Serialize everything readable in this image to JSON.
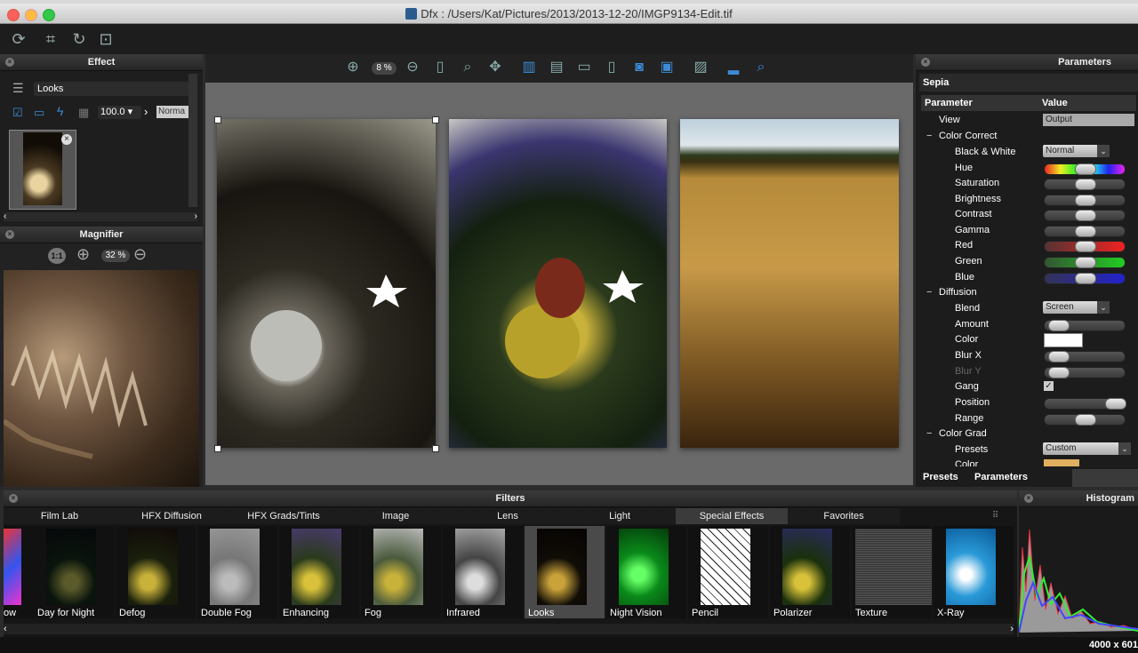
{
  "window": {
    "title": "Dfx : /Users/Kat/Pictures/2013/2013-12-20/IMGP9134-Edit.tif"
  },
  "effect_panel": {
    "title": "Effect",
    "preset_name": "Looks",
    "opacity_value": "100.0",
    "blend_mode": "Norma"
  },
  "magnifier": {
    "title": "Magnifier",
    "ratio_label": "1:1",
    "zoom": "32 %"
  },
  "view_toolbar": {
    "zoom": "8 %"
  },
  "parameters": {
    "title": "Parameters",
    "effect_name": "Sepia",
    "col_parameter": "Parameter",
    "col_value": "Value",
    "view_label": "View",
    "view_value": "Output",
    "color_correct": "Color Correct",
    "bw_label": "Black & White",
    "bw_value": "Normal",
    "hue": "Hue",
    "saturation": "Saturation",
    "brightness": "Brightness",
    "contrast": "Contrast",
    "gamma": "Gamma",
    "red": "Red",
    "green": "Green",
    "blue": "Blue",
    "diffusion": "Diffusion",
    "blend": "Blend",
    "blend_value": "Screen",
    "amount": "Amount",
    "color": "Color",
    "blur_x": "Blur X",
    "blur_y": "Blur Y",
    "gang": "Gang",
    "position": "Position",
    "range": "Range",
    "color_grad": "Color Grad",
    "presets": "Presets",
    "presets_value": "Custom",
    "grad_color": "Color",
    "tab_presets": "Presets",
    "tab_parameters": "Parameters"
  },
  "filters": {
    "title": "Filters",
    "tabs": [
      "Film Lab",
      "HFX Diffusion",
      "HFX Grads/Tints",
      "Image",
      "Lens",
      "Light",
      "Special Effects",
      "Favorites"
    ],
    "items": [
      "ow",
      "Day for Night",
      "Defog",
      "Double Fog",
      "Enhancing",
      "Fog",
      "Infrared",
      "Looks",
      "Night Vision",
      "Pencil",
      "Polarizer",
      "Texture",
      "X-Ray"
    ]
  },
  "histogram": {
    "title": "Histogram",
    "dims": "4000 x 601"
  }
}
